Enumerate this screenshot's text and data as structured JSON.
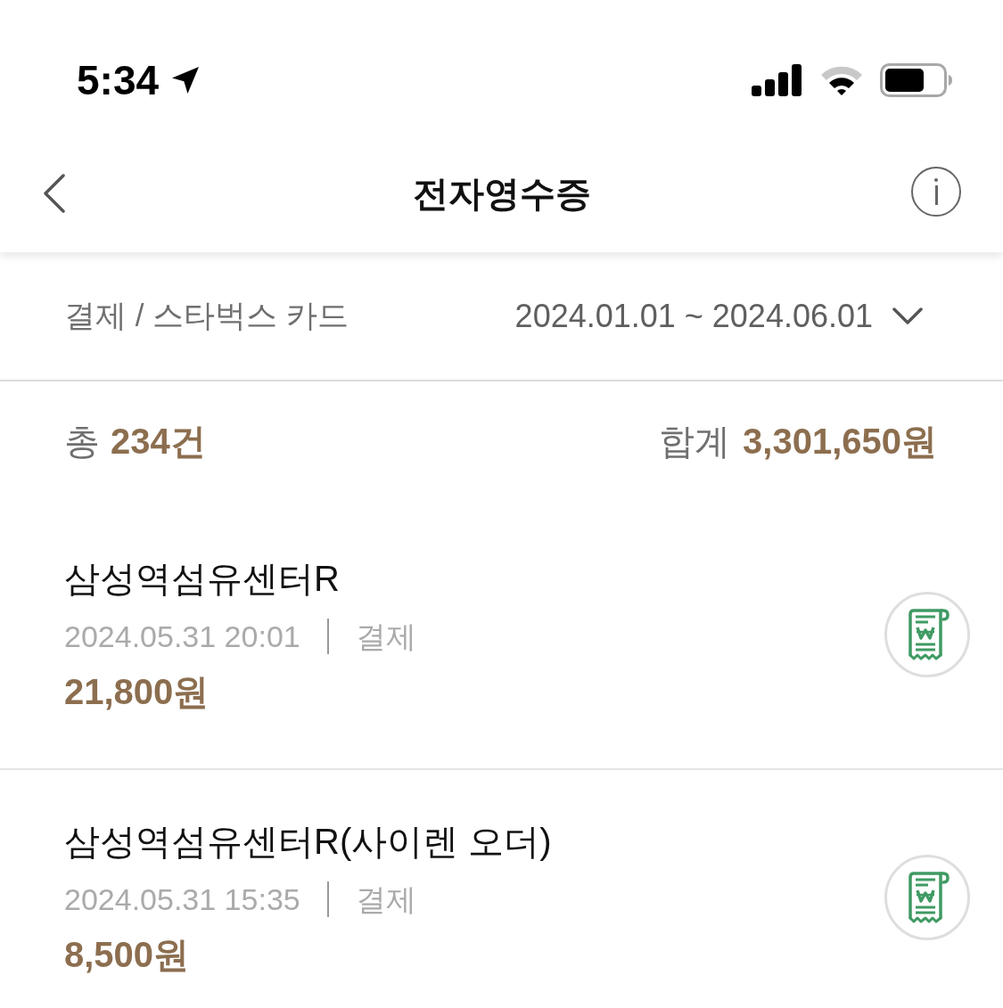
{
  "status_bar": {
    "time": "5:34"
  },
  "nav": {
    "title": "전자영수증"
  },
  "filter": {
    "type": "결제 / 스타벅스 카드",
    "date_range": "2024.01.01 ~ 2024.06.01"
  },
  "summary": {
    "count_label": "총",
    "count": "234건",
    "total_label": "합계",
    "total": "3,301,650원"
  },
  "receipts": [
    {
      "store": "삼성역섬유센터R",
      "datetime": "2024.05.31 20:01",
      "type": "결제",
      "amount": "21,800원"
    },
    {
      "store": "삼성역섬유센터R(사이렌 오더)",
      "datetime": "2024.05.31 15:35",
      "type": "결제",
      "amount": "8,500원"
    }
  ]
}
